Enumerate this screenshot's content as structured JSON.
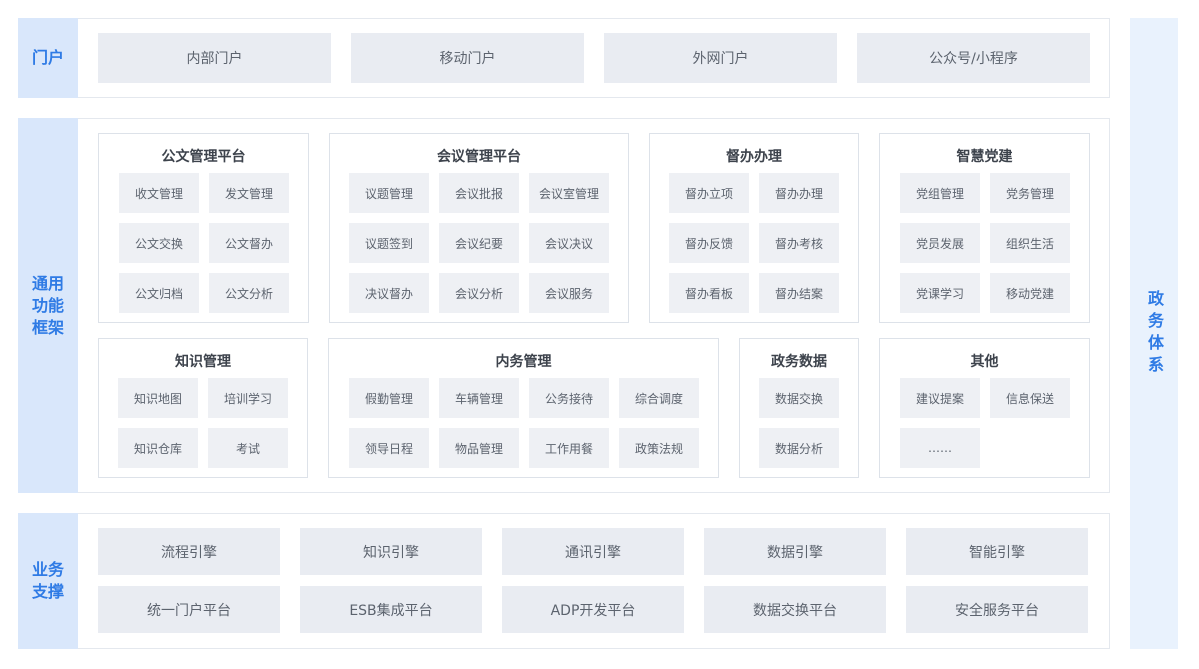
{
  "portal": {
    "label": "门户",
    "items": [
      "内部门户",
      "移动门户",
      "外网门户",
      "公众号/小程序"
    ]
  },
  "framework": {
    "label_lines": [
      "通用",
      "功能",
      "框架"
    ],
    "groups": [
      {
        "title": "公文管理平台",
        "cols": 2,
        "items": [
          "收文管理",
          "发文管理",
          "公文交换",
          "公文督办",
          "公文归档",
          "公文分析"
        ]
      },
      {
        "title": "会议管理平台",
        "cols": 3,
        "items": [
          "议题管理",
          "会议批报",
          "会议室管理",
          "议题签到",
          "会议纪要",
          "会议决议",
          "决议督办",
          "会议分析",
          "会议服务"
        ]
      },
      {
        "title": "督办办理",
        "cols": 2,
        "items": [
          "督办立项",
          "督办办理",
          "督办反馈",
          "督办考核",
          "督办看板",
          "督办结案"
        ]
      },
      {
        "title": "智慧党建",
        "cols": 2,
        "items": [
          "党组管理",
          "党务管理",
          "党员发展",
          "组织生活",
          "党课学习",
          "移动党建"
        ]
      },
      {
        "title": "知识管理",
        "cols": 2,
        "items": [
          "知识地图",
          "培训学习",
          "知识仓库",
          "考试"
        ]
      },
      {
        "title": "内务管理",
        "cols": 4,
        "items": [
          "假勤管理",
          "车辆管理",
          "公务接待",
          "综合调度",
          "领导日程",
          "物品管理",
          "工作用餐",
          "政策法规"
        ]
      },
      {
        "title": "政务数据",
        "cols": 1,
        "items": [
          "数据交换",
          "数据分析"
        ]
      },
      {
        "title": "其他",
        "cols": 2,
        "items": [
          "建议提案",
          "信息保送",
          "……"
        ]
      }
    ]
  },
  "support": {
    "label_lines": [
      "业务",
      "支撑"
    ],
    "rows": [
      [
        "流程引擎",
        "知识引擎",
        "通讯引擎",
        "数据引擎",
        "智能引擎"
      ],
      [
        "统一门户平台",
        "ESB集成平台",
        "ADP开发平台",
        "数据交换平台",
        "安全服务平台"
      ]
    ]
  },
  "side": {
    "label": "政务体系"
  }
}
